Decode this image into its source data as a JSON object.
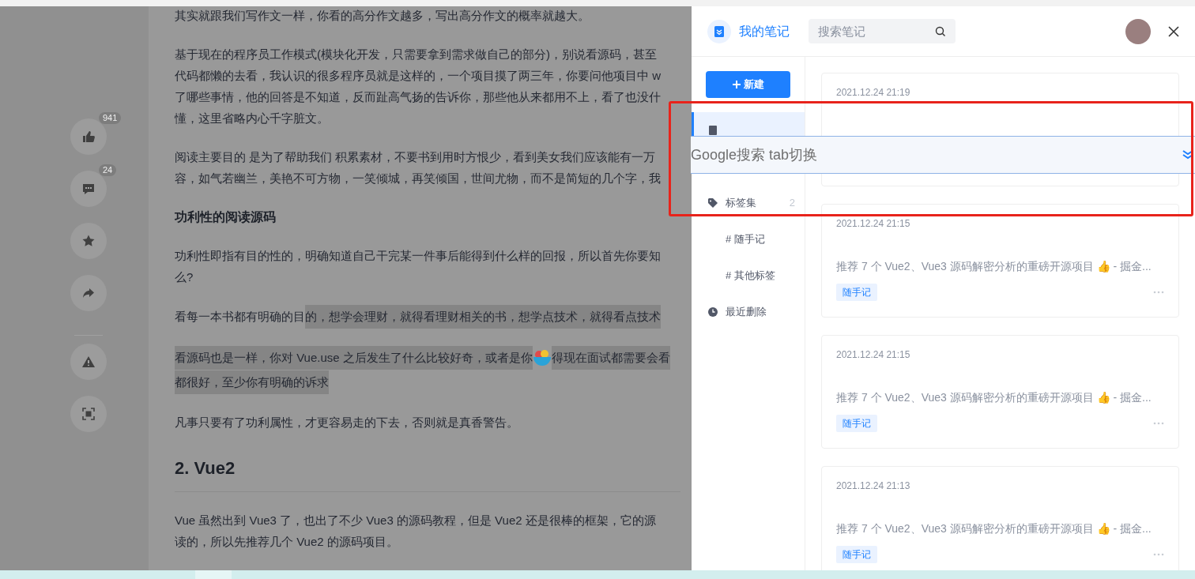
{
  "article": {
    "blocks": [
      {
        "kind": "para",
        "lines": [
          [
            {
              "text": "其实就跟我们写作文一样，你看的高分作文越多，写出高分作文的概率就越大。",
              "highlighted": false
            }
          ]
        ]
      },
      {
        "kind": "para",
        "lines": [
          [
            {
              "text": "基于现在的程序员工作模式(模块化开发，只需要拿到需求做自己的部分)，别说看源码，甚至",
              "highlighted": false
            }
          ],
          [
            {
              "text": "代码都懒的去看，我认识的很多程序员就是这样的，一个项目摸了两三年，你要问他项目中 w",
              "highlighted": false
            }
          ],
          [
            {
              "text": "了哪些事情，他的回答是不知道，反而趾高气扬的告诉你，那些他从来都用不上，看了也没什",
              "highlighted": false
            }
          ],
          [
            {
              "text": "懂，这里省略内心千字脏文。",
              "highlighted": false
            }
          ]
        ]
      },
      {
        "kind": "para",
        "lines": [
          [
            {
              "text": "阅读主要目的 是为了帮助我们 积累素材，不要书到用时方恨少，看到美女我们应该能有一万",
              "highlighted": false
            }
          ],
          [
            {
              "text": "容，如气若幽兰，美艳不可方物，一笑倾城，再笑倾国，世间尤物，而不是简短的几个字，我",
              "highlighted": false
            }
          ]
        ]
      },
      {
        "kind": "heading",
        "text": "功利性的阅读源码"
      },
      {
        "kind": "para",
        "lines": [
          [
            {
              "text": "功利性即指有目的性的，明确知道自己干完某一件事后能得到什么样的回报，所以首先你要知",
              "highlighted": false
            }
          ],
          [
            {
              "text": "么?",
              "highlighted": false
            }
          ]
        ]
      },
      {
        "kind": "para",
        "lines": [
          [
            {
              "text": "看每一本书都有明确的目",
              "highlighted": false
            },
            {
              "text": "的，想学会理财，就得看理财相关的书，想学点技术，就得看点技术",
              "highlighted": true
            }
          ]
        ]
      },
      {
        "kind": "para",
        "lines": [
          [
            {
              "text": "看源码也是一样，你对 Vue.use 之后发生了什么比较好奇，或者是你",
              "highlighted": true
            },
            {
              "kind": "sticker"
            },
            {
              "text": "得现在面试都需要会看",
              "highlighted": true
            }
          ],
          [
            {
              "text": "都很好，至少你有明确的诉求",
              "highlighted": true
            }
          ]
        ]
      },
      {
        "kind": "para",
        "lines": [
          [
            {
              "text": "凡事只要有了功利属性，才更容易走的下去，否则就是真香警告。",
              "highlighted": false
            }
          ]
        ]
      },
      {
        "kind": "h2",
        "text": "2. Vue2"
      },
      {
        "kind": "para",
        "lines": [
          [
            {
              "text": "Vue 虽然出到 Vue3 了，也出了不少 Vue3 的源码教程，但是 Vue2 还是很棒的框架，它的源",
              "highlighted": false
            }
          ],
          [
            {
              "text": "读的，所以先推荐几个 Vue2 的源码项目。",
              "highlighted": false
            }
          ]
        ]
      }
    ]
  },
  "actions": [
    {
      "kind": "like",
      "count": "941"
    },
    {
      "kind": "comment",
      "count": "24"
    },
    {
      "kind": "star"
    },
    {
      "kind": "share"
    },
    {
      "kind": "divider"
    },
    {
      "kind": "report"
    },
    {
      "kind": "fullscreen"
    }
  ],
  "notes_panel": {
    "title": "我的笔记",
    "search": {
      "placeholder": "搜索笔记"
    },
    "new_button": "新建",
    "nav": [
      {
        "kind": "all",
        "selected": true
      },
      {
        "kind": "tags",
        "label": "标签集",
        "count": "2",
        "selected": false
      },
      {
        "kind": "tag",
        "label": "# 随手记",
        "selected": false
      },
      {
        "kind": "tag",
        "label": "# 其他标签",
        "selected": false
      },
      {
        "kind": "trash",
        "label": "最近删除",
        "selected": false
      }
    ],
    "notes": [
      {
        "date": "2021.12.24 21:19"
      },
      {
        "date": "2021.12.24 21:15",
        "title": "推荐 7 个 Vue2、Vue3 源码解密分析的重磅开源项目 👍 - 掘金...",
        "tag": "随手记"
      },
      {
        "date": "2021.12.24 21:15",
        "title": "推荐 7 个 Vue2、Vue3 源码解密分析的重磅开源项目 👍 - 掘金...",
        "tag": "随手记"
      },
      {
        "date": "2021.12.24 21:13",
        "title": "推荐 7 个 Vue2、Vue3 源码解密分析的重磅开源项目 👍 - 掘金...",
        "tag": "随手记"
      }
    ]
  },
  "popup": {
    "text": "Google搜索 tab切换"
  }
}
